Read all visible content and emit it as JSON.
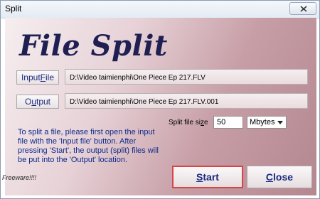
{
  "window": {
    "title": "Split"
  },
  "app": {
    "heading": "File Split"
  },
  "input_file": {
    "button": {
      "before": "Input ",
      "accel": "F",
      "after": "ile"
    },
    "path": "D:\\Video taimienphi\\One Piece Ep 217.FLV"
  },
  "output": {
    "button": {
      "before": "O",
      "accel": "u",
      "after": "tput"
    },
    "path": "D:\\Video taimienphi\\One Piece Ep 217.FLV.001"
  },
  "split_size": {
    "label_before": "Split file si",
    "label_accel": "z",
    "label_after": "e",
    "value": "50",
    "unit": "Mbytes"
  },
  "instructions": "To split a file, please first open the input file with the 'Input file' button. After pressing 'Start', the output (split) files will be put into the 'Output' location.",
  "actions": {
    "start": {
      "accel": "S",
      "rest": "tart"
    },
    "close": {
      "accel": "C",
      "rest": "lose"
    }
  },
  "footer": "Freeware!!!!"
}
